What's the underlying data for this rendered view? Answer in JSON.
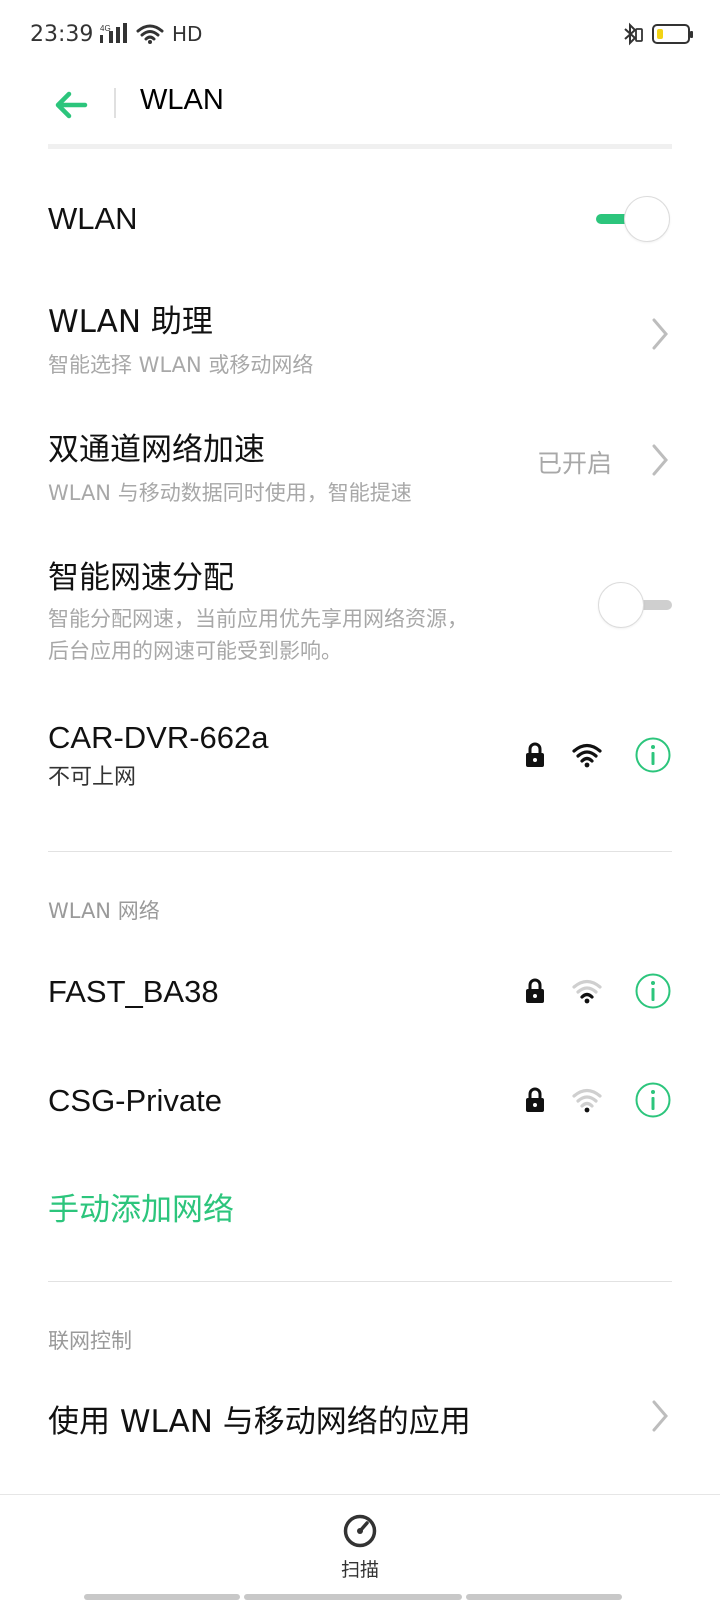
{
  "status_bar": {
    "time": "23:39",
    "network_label": "4G",
    "hd_label": "HD",
    "battery_color": "#f2d314"
  },
  "header": {
    "back_icon": "back-arrow-icon",
    "title": "WLAN"
  },
  "settings": {
    "wlan": {
      "title": "WLAN",
      "enabled": true
    },
    "assistant": {
      "title": "WLAN 助理",
      "subtitle": "智能选择 WLAN 或移动网络"
    },
    "dual_channel": {
      "title": "双通道网络加速",
      "subtitle": "WLAN 与移动数据同时使用，智能提速",
      "value": "已开启"
    },
    "speed_alloc": {
      "title": "智能网速分配",
      "subtitle_line1": "智能分配网速，当前应用优先享用网络资源，",
      "subtitle_line2": "后台应用的网速可能受到影响。",
      "enabled": false
    }
  },
  "connected_network": {
    "ssid": "CAR-DVR-662a",
    "status": "不可上网",
    "secured": true,
    "signal": "full"
  },
  "networks_section": {
    "label": "WLAN 网络",
    "items": [
      {
        "ssid": "FAST_BA38",
        "secured": true,
        "signal": "weak"
      },
      {
        "ssid": "CSG-Private",
        "secured": true,
        "signal": "weak"
      }
    ],
    "add_label": "手动添加网络"
  },
  "control_section": {
    "label": "联网控制",
    "apps_item": "使用 WLAN 与移动网络的应用"
  },
  "bottom_bar": {
    "scan_label": "扫描",
    "scan_icon": "scan-icon"
  },
  "colors": {
    "accent": "#2cc57c",
    "secondary_text": "#a8a8a8"
  }
}
